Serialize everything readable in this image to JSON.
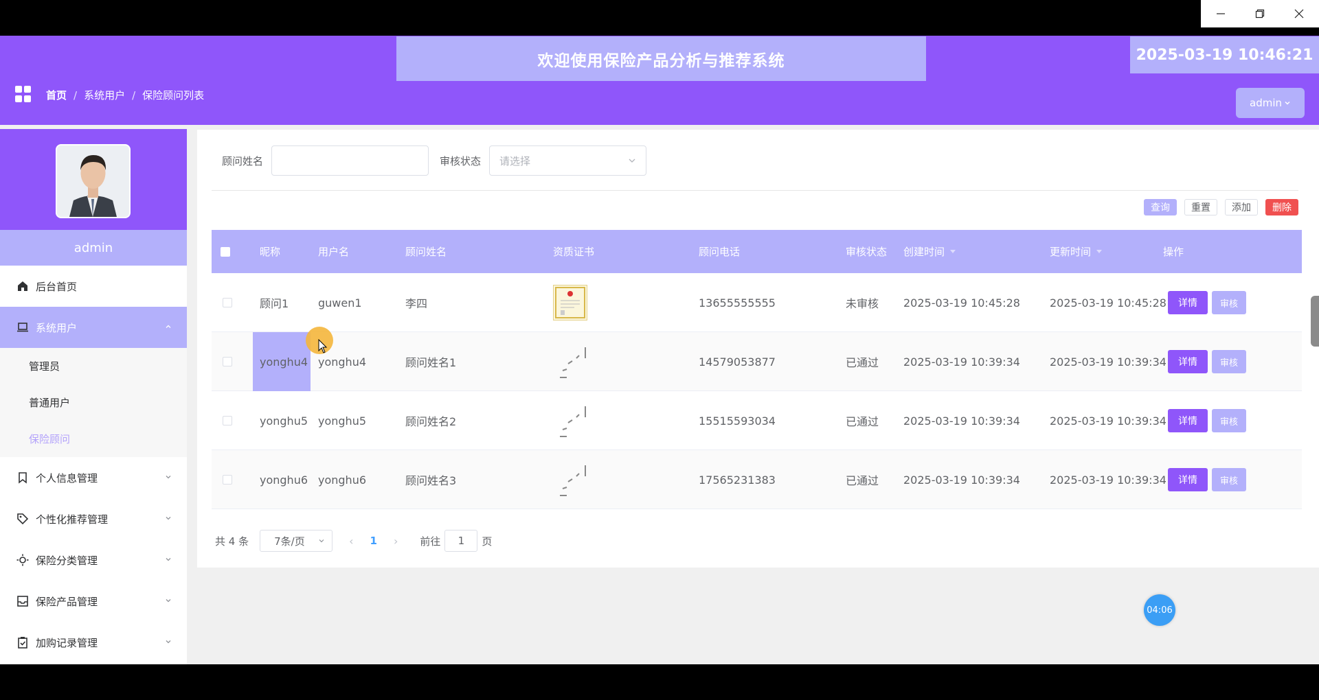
{
  "header": {
    "welcome": "欢迎使用保险产品分析与推荐系统",
    "datetime": "2025-03-19 10:46:21",
    "user_menu": "admin"
  },
  "breadcrumb": [
    "首页",
    "系统用户",
    "保险顾问列表"
  ],
  "sidebar": {
    "username": "admin",
    "items": [
      {
        "label": "后台首页",
        "icon": "home-icon"
      },
      {
        "label": "系统用户",
        "icon": "laptop-icon",
        "expanded": true,
        "children": [
          "管理员",
          "普通用户",
          "保险顾问"
        ]
      },
      {
        "label": "个人信息管理",
        "icon": "bookmark-icon"
      },
      {
        "label": "个性化推荐管理",
        "icon": "tag-icon"
      },
      {
        "label": "保险分类管理",
        "icon": "sun-icon"
      },
      {
        "label": "保险产品管理",
        "icon": "inbox-icon"
      },
      {
        "label": "加购记录管理",
        "icon": "clipboard-check-icon"
      }
    ]
  },
  "filters": {
    "name_label": "顾问姓名",
    "name_value": "",
    "status_label": "审核状态",
    "status_placeholder": "请选择"
  },
  "actions": {
    "query": "查询",
    "reset": "重置",
    "add": "添加",
    "delete": "删除"
  },
  "table": {
    "columns": [
      "昵称",
      "用户名",
      "顾问姓名",
      "资质证书",
      "顾问电话",
      "审核状态",
      "创建时间",
      "更新时间",
      "操作"
    ],
    "rows": [
      {
        "nickname": "顾问1",
        "username": "guwen1",
        "name": "李四",
        "cert": "image",
        "phone": "13655555555",
        "status": "未审核",
        "created": "2025-03-19 10:45:28",
        "updated": "2025-03-19 10:45:28"
      },
      {
        "nickname": "yonghu4",
        "username": "yonghu4",
        "name": "顾问姓名1",
        "cert": "loading",
        "phone": "14579053877",
        "status": "已通过",
        "created": "2025-03-19 10:39:34",
        "updated": "2025-03-19 10:39:34"
      },
      {
        "nickname": "yonghu5",
        "username": "yonghu5",
        "name": "顾问姓名2",
        "cert": "loading",
        "phone": "15515593034",
        "status": "已通过",
        "created": "2025-03-19 10:39:34",
        "updated": "2025-03-19 10:39:34"
      },
      {
        "nickname": "yonghu6",
        "username": "yonghu6",
        "name": "顾问姓名3",
        "cert": "loading",
        "phone": "17565231383",
        "status": "已通过",
        "created": "2025-03-19 10:39:34",
        "updated": "2025-03-19 10:39:34"
      }
    ],
    "row_detail_label": "详情",
    "row_audit_label": "审核"
  },
  "pagination": {
    "total": "共 4 条",
    "page_size": "7条/页",
    "current_page": "1",
    "goto_prefix": "前往",
    "goto_value": "1",
    "goto_suffix": "页"
  },
  "overlay": {
    "timer": "04:06"
  },
  "colors": {
    "primary": "#8f56fa",
    "light": "#b3b0fb",
    "danger": "#f05050"
  }
}
